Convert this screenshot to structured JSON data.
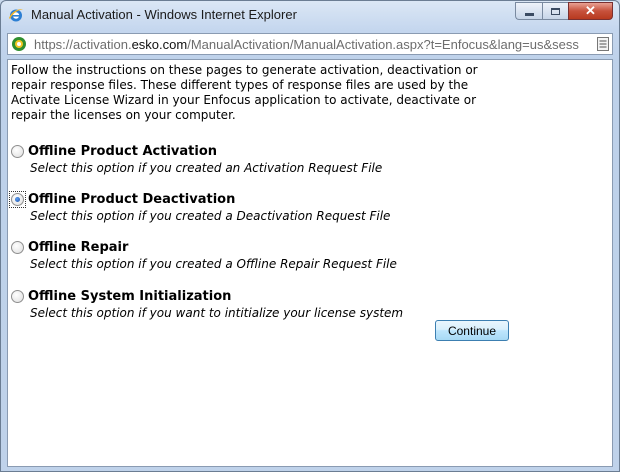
{
  "window": {
    "title": "Manual Activation - Windows Internet Explorer",
    "close_glyph": "✕"
  },
  "address": {
    "prefix": "https://activation.",
    "host": "esko.com",
    "suffix": "/ManualActivation/ManualActivation.aspx?t=Enfocus&lang=us&sess"
  },
  "content": {
    "intro": "Follow the instructions on these pages to generate activation, deactivation or repair response files. These different types of response files are used by the Activate License Wizard in your Enfocus application to activate, deactivate or repair the licenses on your computer.",
    "options": [
      {
        "label": "Offline Product Activation",
        "description": "Select this option if you created an Activation Request File",
        "selected": false
      },
      {
        "label": "Offline Product Deactivation",
        "description": "Select this option if you created a Deactivation Request File",
        "selected": true
      },
      {
        "label": "Offline Repair",
        "description": "Select this option if you created a Offline Repair Request File",
        "selected": false
      },
      {
        "label": "Offline System Initialization",
        "description": "Select this option if you want to intitialize your license system",
        "selected": false
      }
    ],
    "continue_label": "Continue"
  },
  "icons": {
    "app": "ie-icon",
    "address": "ie-page-icon",
    "compat": "page-icon"
  }
}
